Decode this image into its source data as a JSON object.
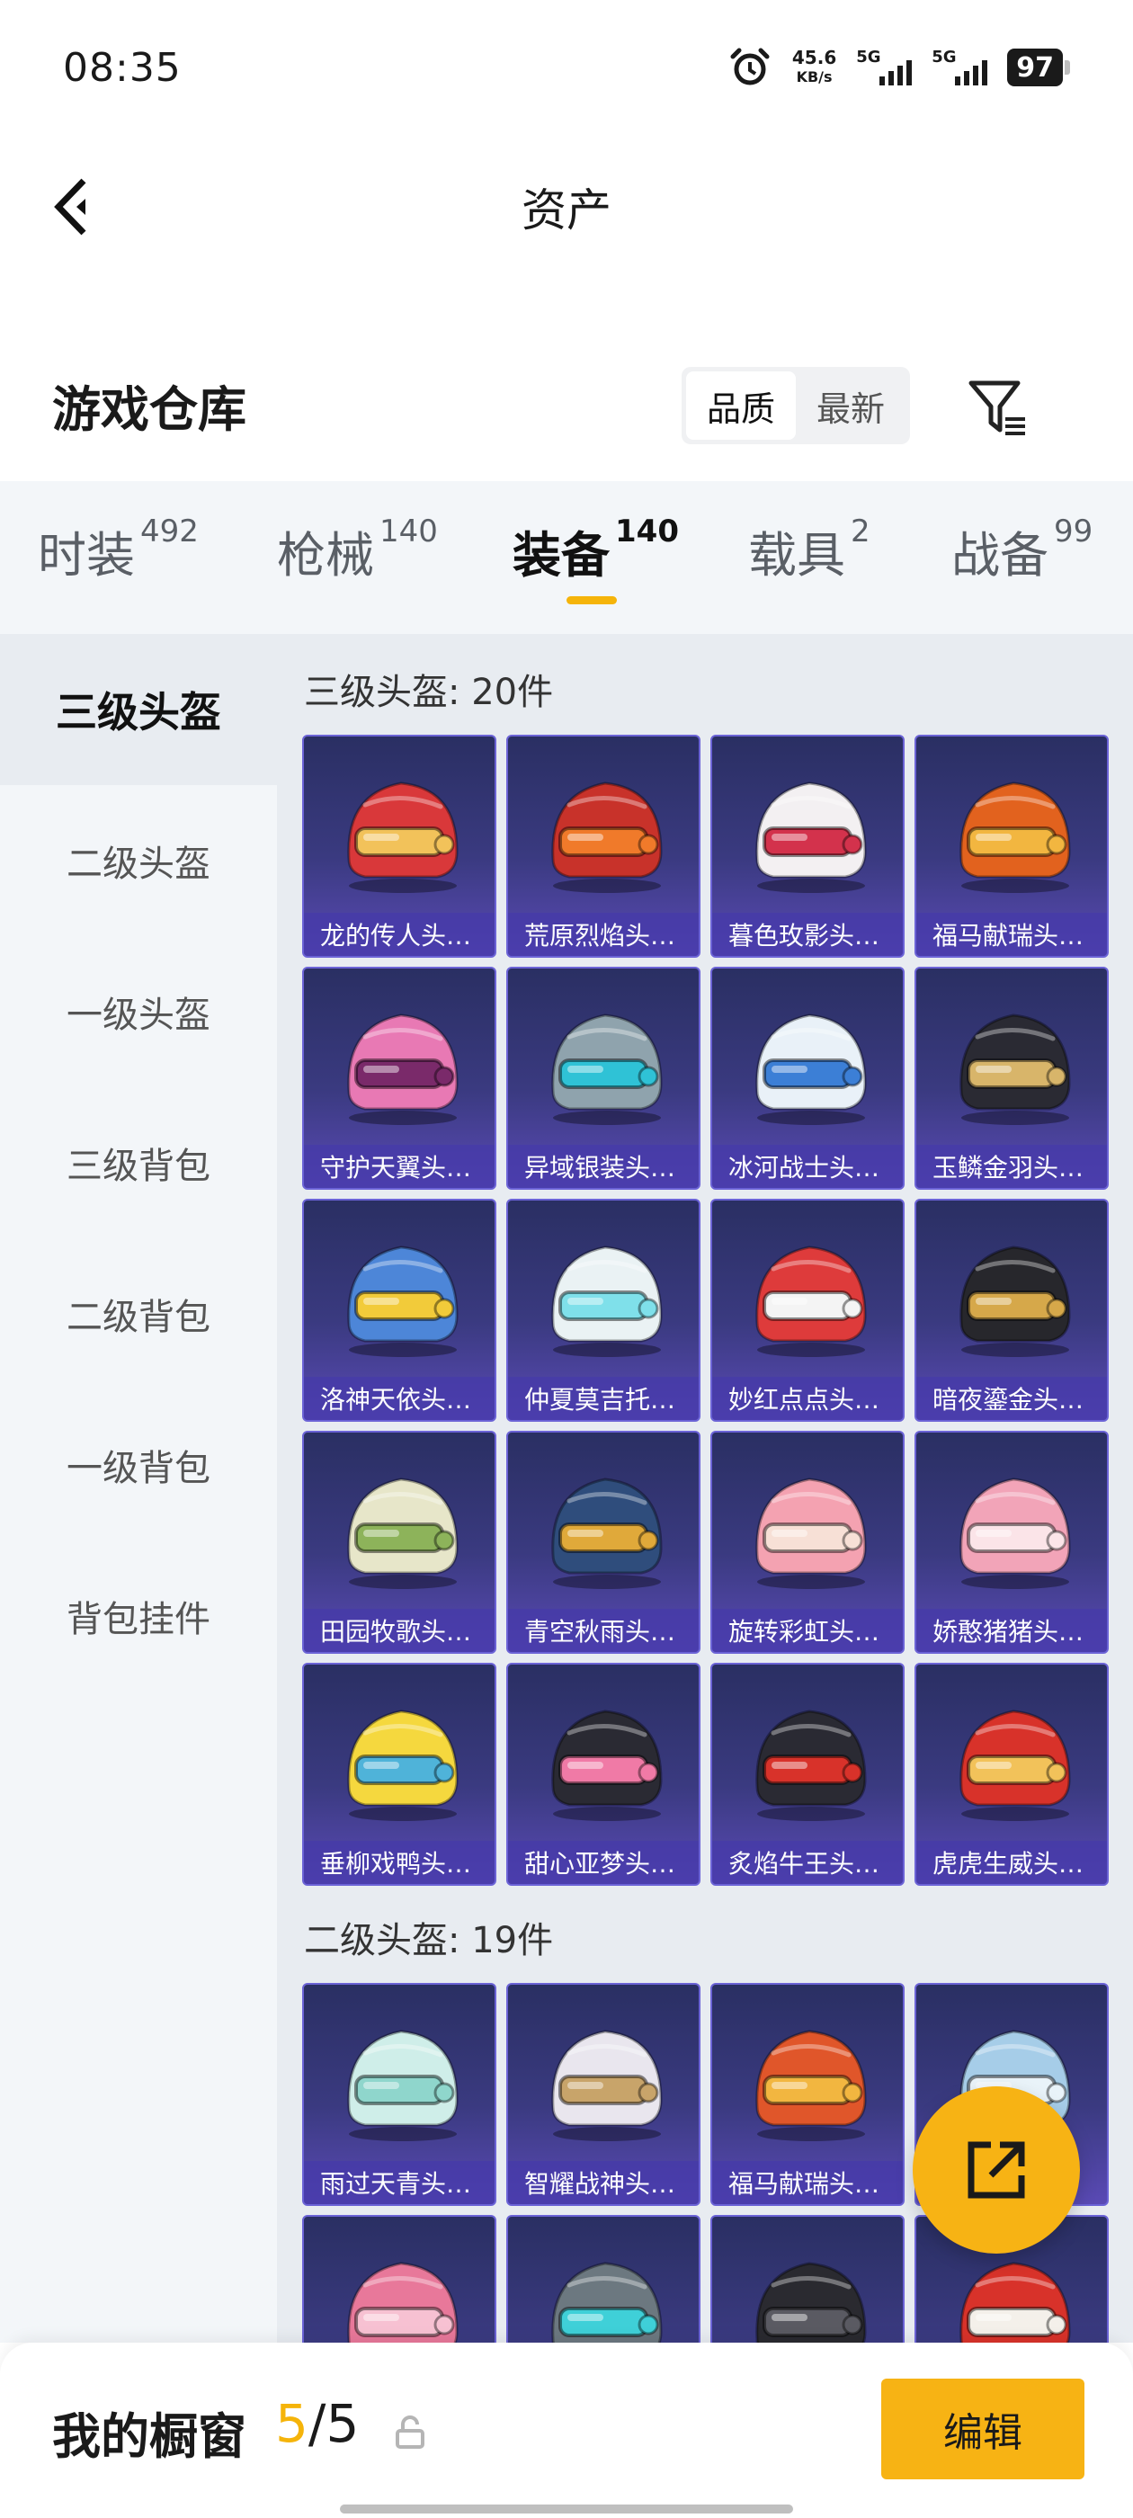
{
  "status_bar": {
    "time": "08:35",
    "speed_value": "45.6",
    "speed_unit": "KB/s",
    "sim1": "5G",
    "sim2": "5G",
    "battery": "97"
  },
  "header": {
    "title": "资产",
    "back_icon": "chevron-left-icon"
  },
  "warehouse": {
    "title": "游戏仓库",
    "sort_options": [
      "品质",
      "最新"
    ],
    "active_sort": "品质",
    "filter_icon": "filter-icon"
  },
  "categories": [
    {
      "name": "时装",
      "count": "492"
    },
    {
      "name": "枪械",
      "count": "140"
    },
    {
      "name": "装备",
      "count": "140"
    },
    {
      "name": "载具",
      "count": "2"
    },
    {
      "name": "战备",
      "count": "99"
    }
  ],
  "active_category": "装备",
  "sidebar": {
    "items": [
      "三级头盔",
      "二级头盔",
      "一级头盔",
      "三级背包",
      "二级背包",
      "一级背包",
      "背包挂件"
    ],
    "active": "三级头盔"
  },
  "sections": [
    {
      "title": "三级头盔: 20件",
      "items": [
        {
          "name": "龙的传人头…",
          "colors": [
            "#d9383a",
            "#f2c25a"
          ]
        },
        {
          "name": "荒原烈焰头…",
          "colors": [
            "#c8322a",
            "#f07a2a"
          ]
        },
        {
          "name": "暮色玫影头…",
          "colors": [
            "#f3f0f2",
            "#d3324c"
          ]
        },
        {
          "name": "福马献瑞头…",
          "colors": [
            "#e2621e",
            "#f2b640"
          ]
        },
        {
          "name": "守护天翼头…",
          "colors": [
            "#e879b4",
            "#7a2a6a"
          ]
        },
        {
          "name": "异域银装头…",
          "colors": [
            "#8fa3ad",
            "#2fc2d6"
          ]
        },
        {
          "name": "冰河战士头…",
          "colors": [
            "#e9f1f8",
            "#3c7fd6"
          ]
        },
        {
          "name": "玉鳞金羽头…",
          "colors": [
            "#2a2a33",
            "#d8b56a"
          ]
        },
        {
          "name": "洛神天依头…",
          "colors": [
            "#4d86d8",
            "#f2cb3a"
          ]
        },
        {
          "name": "仲夏莫吉托…",
          "colors": [
            "#eaf2f4",
            "#7fe0ea"
          ]
        },
        {
          "name": "妙红点点头…",
          "colors": [
            "#de3b3b",
            "#f4f4f4"
          ]
        },
        {
          "name": "暗夜鎏金头…",
          "colors": [
            "#27272c",
            "#d6a84a"
          ]
        },
        {
          "name": "田园牧歌头…",
          "colors": [
            "#e7e6c9",
            "#8db35a"
          ]
        },
        {
          "name": "青空秋雨头…",
          "colors": [
            "#2f4d7c",
            "#e0a93a"
          ]
        },
        {
          "name": "旋转彩虹头…",
          "colors": [
            "#f4a2b1",
            "#f7e0d6"
          ]
        },
        {
          "name": "娇憨猪猪头…",
          "colors": [
            "#f2a4b8",
            "#fbe4e8"
          ]
        },
        {
          "name": "垂柳戏鸭头…",
          "colors": [
            "#f5d83e",
            "#4fb3d9"
          ]
        },
        {
          "name": "甜心亚梦头…",
          "colors": [
            "#2a2a33",
            "#f07aa6"
          ]
        },
        {
          "name": "炙焰牛王头…",
          "colors": [
            "#2a2a33",
            "#d8322a"
          ]
        },
        {
          "name": "虎虎生威头…",
          "colors": [
            "#d8322a",
            "#f2c25a"
          ]
        }
      ]
    },
    {
      "title": "二级头盔: 19件",
      "items": [
        {
          "name": "雨过天青头…",
          "colors": [
            "#cfeee9",
            "#8fd6cc"
          ]
        },
        {
          "name": "智耀战神头…",
          "colors": [
            "#e9e6ee",
            "#c8a46a"
          ]
        },
        {
          "name": "福马献瑞头…",
          "colors": [
            "#e0562a",
            "#f2b640"
          ]
        },
        {
          "name": "",
          "colors": [
            "#a6cde8",
            "#e9f3f9"
          ]
        },
        {
          "name": "",
          "colors": [
            "#e8789a",
            "#f7c1d2"
          ]
        },
        {
          "name": "",
          "colors": [
            "#6c7880",
            "#3fd0d8"
          ]
        },
        {
          "name": "",
          "colors": [
            "#2a2a30",
            "#5a5a62"
          ]
        },
        {
          "name": "",
          "colors": [
            "#d8322a",
            "#f4f0ea"
          ]
        }
      ]
    }
  ],
  "fab": {
    "icon": "share-icon"
  },
  "bottom": {
    "showcase_label": "我的橱窗",
    "current": "5",
    "total": "5",
    "separator": "/",
    "lock_icon": "lock-icon",
    "edit_label": "编辑"
  }
}
